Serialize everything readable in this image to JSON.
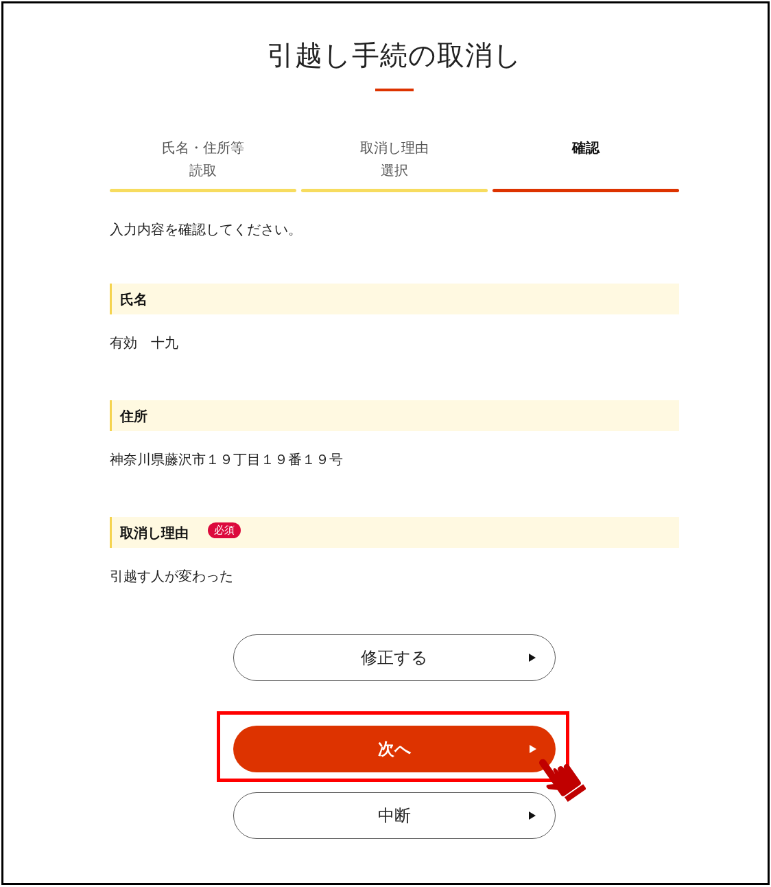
{
  "title": "引越し手続の取消し",
  "steps": [
    {
      "lines": [
        "氏名・住所等",
        "読取"
      ],
      "selected": false
    },
    {
      "lines": [
        "取消し理由",
        "選択"
      ],
      "selected": false
    },
    {
      "lines": [
        "確認"
      ],
      "selected": true
    }
  ],
  "instruction": "入力内容を確認してください。",
  "fields": [
    {
      "label": "氏名",
      "value": "有効　十九"
    },
    {
      "label": "住所",
      "value": "神奈川県藤沢市１９丁目１９番１９号"
    },
    {
      "label": "取消し理由",
      "badge": "必須",
      "value": "引越す人が変わった"
    }
  ],
  "buttons": [
    {
      "label": "修正する",
      "kind": "secondary",
      "highlighted": false
    },
    {
      "label": "次へ",
      "kind": "primary",
      "highlighted": true
    },
    {
      "label": "中断",
      "kind": "secondary",
      "highlighted": false
    }
  ]
}
